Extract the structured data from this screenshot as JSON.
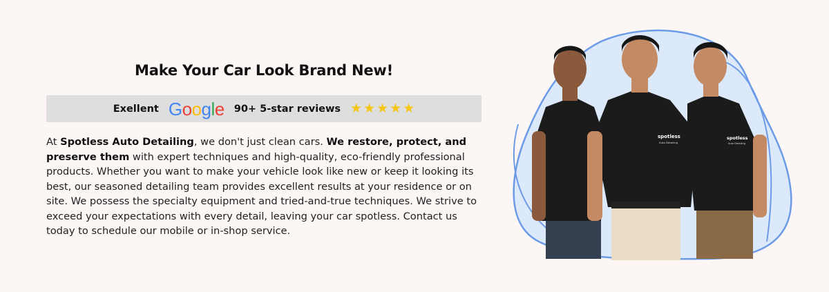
{
  "heading": "Make Your Car Look Brand New!",
  "reviews": {
    "label": "Exellent",
    "google_letters": [
      {
        "ch": "G",
        "color": "#4285F4"
      },
      {
        "ch": "o",
        "color": "#EA4335"
      },
      {
        "ch": "o",
        "color": "#FBBC05"
      },
      {
        "ch": "g",
        "color": "#4285F4"
      },
      {
        "ch": "l",
        "color": "#34A853"
      },
      {
        "ch": "e",
        "color": "#EA4335"
      }
    ],
    "count_text": "90+ 5-star reviews",
    "stars": 5
  },
  "body": {
    "p1": "At ",
    "b1": "Spotless Auto Detailing",
    "p2": ", we don't just clean cars. ",
    "b2": "We restore, protect, and preserve them",
    "p3": " with expert techniques and high-quality, eco-friendly professional products. Whether you want to make your vehicle look like new or keep it looking its best, our seasoned detailing team provides excellent results at your residence or on site. We possess the specialty equipment and tried-and-true techniques. We strive to exceed your expectations with every detail, leaving your car spotless. Contact us today to schedule our mobile or in-shop service."
  },
  "shirt_logo": {
    "brand": "spotless",
    "sub": "Auto Detailing"
  },
  "colors": {
    "background": "#fcf6f5",
    "review_bar": "#dedede",
    "star": "#f5c518",
    "blob_fill": "#dce9fb",
    "blob_stroke": "#6b9be6"
  }
}
